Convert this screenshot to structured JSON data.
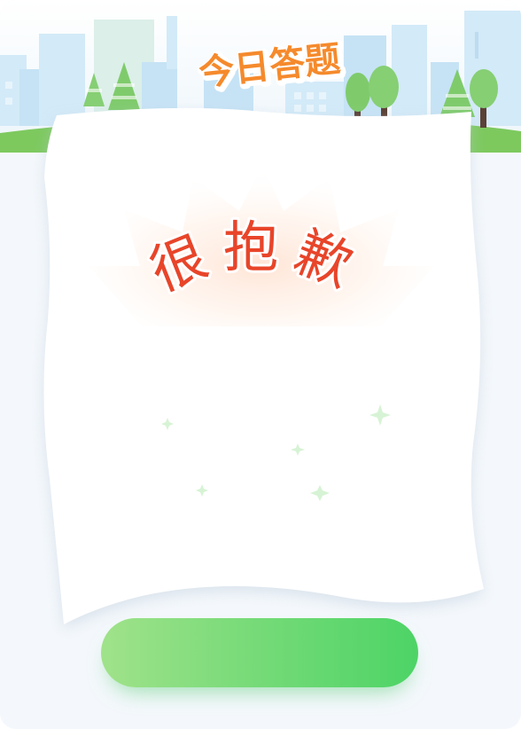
{
  "modal": {
    "title": "今日答题",
    "message": "很抱歉",
    "confirm_button_label": ""
  },
  "colors": {
    "title_orange": "#f58a2c",
    "message_red": "#e8452a",
    "button_green": "#4dd466",
    "sky_building_blue": "#cfe8f7",
    "grass_green": "#7dc95e"
  },
  "icons": {
    "sparkles": "four-point-star",
    "trees": [
      "pine-tree",
      "round-tree"
    ]
  }
}
